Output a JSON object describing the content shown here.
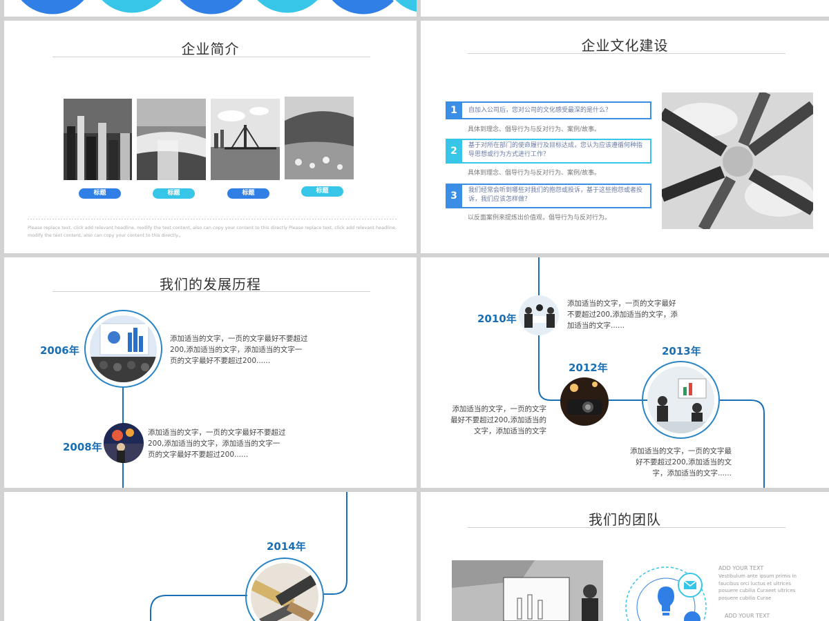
{
  "slide_intro": {
    "title": "企业简介",
    "labels": [
      "标题",
      "标题",
      "标题",
      "标题"
    ],
    "footnote": "Please replace text, click add relevant headline, modify the text content, also can copy your content to this directly Please replace text, click add relevant headline, modify the text content, also can copy your content to this directly.。"
  },
  "slide_culture": {
    "title": "企业文化建设",
    "items": [
      {
        "num": "1",
        "question": "自加入公司后，您对公司的文化感受最深的是什么？",
        "answer": "具体到理念、倡导行为与反对行为、案例/故事。"
      },
      {
        "num": "2",
        "question": "基于对所在部门的使命履行及目标达成，您认为应该遵循何种指导思想或行为方式进行工作？",
        "answer": "具体到理念、倡导行为与反对行为、案例/故事。"
      },
      {
        "num": "3",
        "question": "我们经常会听到哪些对我们的抱怨或投诉，基于这些抱怨或者投诉，我们应该怎样做？",
        "answer": "以反面案例来提炼出价值观，倡导行为与反对行为。"
      }
    ]
  },
  "slide_history": {
    "title": "我们的发展历程",
    "y2006": "2006年",
    "t2006": "添加适当的文字，一页的文字最好不要超过200,添加适当的文字，添加适当的文字一页的文字最好不要超过200......",
    "y2008": "2008年",
    "t2008": "添加适当的文字，一页的文字最好不要超过200,添加适当的文字，添加适当的文字一页的文字最好不要超过200......"
  },
  "slide_timeline": {
    "y2010": "2010年",
    "t2010": "添加适当的文字，一页的文字最好不要超过200,添加适当的文字，添加适当的文字......",
    "y2012": "2012年",
    "t2012": "添加适当的文字，一页的文字最好不要超过200,添加适当的文字，添加适当的文字",
    "y2013": "2013年",
    "t2013": "添加适当的文字，一页的文字最好不要超过200,添加适当的文字，添加适当的文字......"
  },
  "slide_2014": {
    "y2014": "2014年"
  },
  "slide_team": {
    "title": "我们的团队",
    "add1": "ADD YOUR TEXT",
    "desc1": "Vestibulum ante ipsum primis in faucibus orci luctus et ultrices posuere cubilia Curaeet ultrices posuere cubilia Curae",
    "add2": "ADD YOUR TEXT"
  },
  "colors": {
    "primary": "#2f7fe6",
    "cyan": "#37c6e8",
    "timeline": "#1a6fb4"
  }
}
